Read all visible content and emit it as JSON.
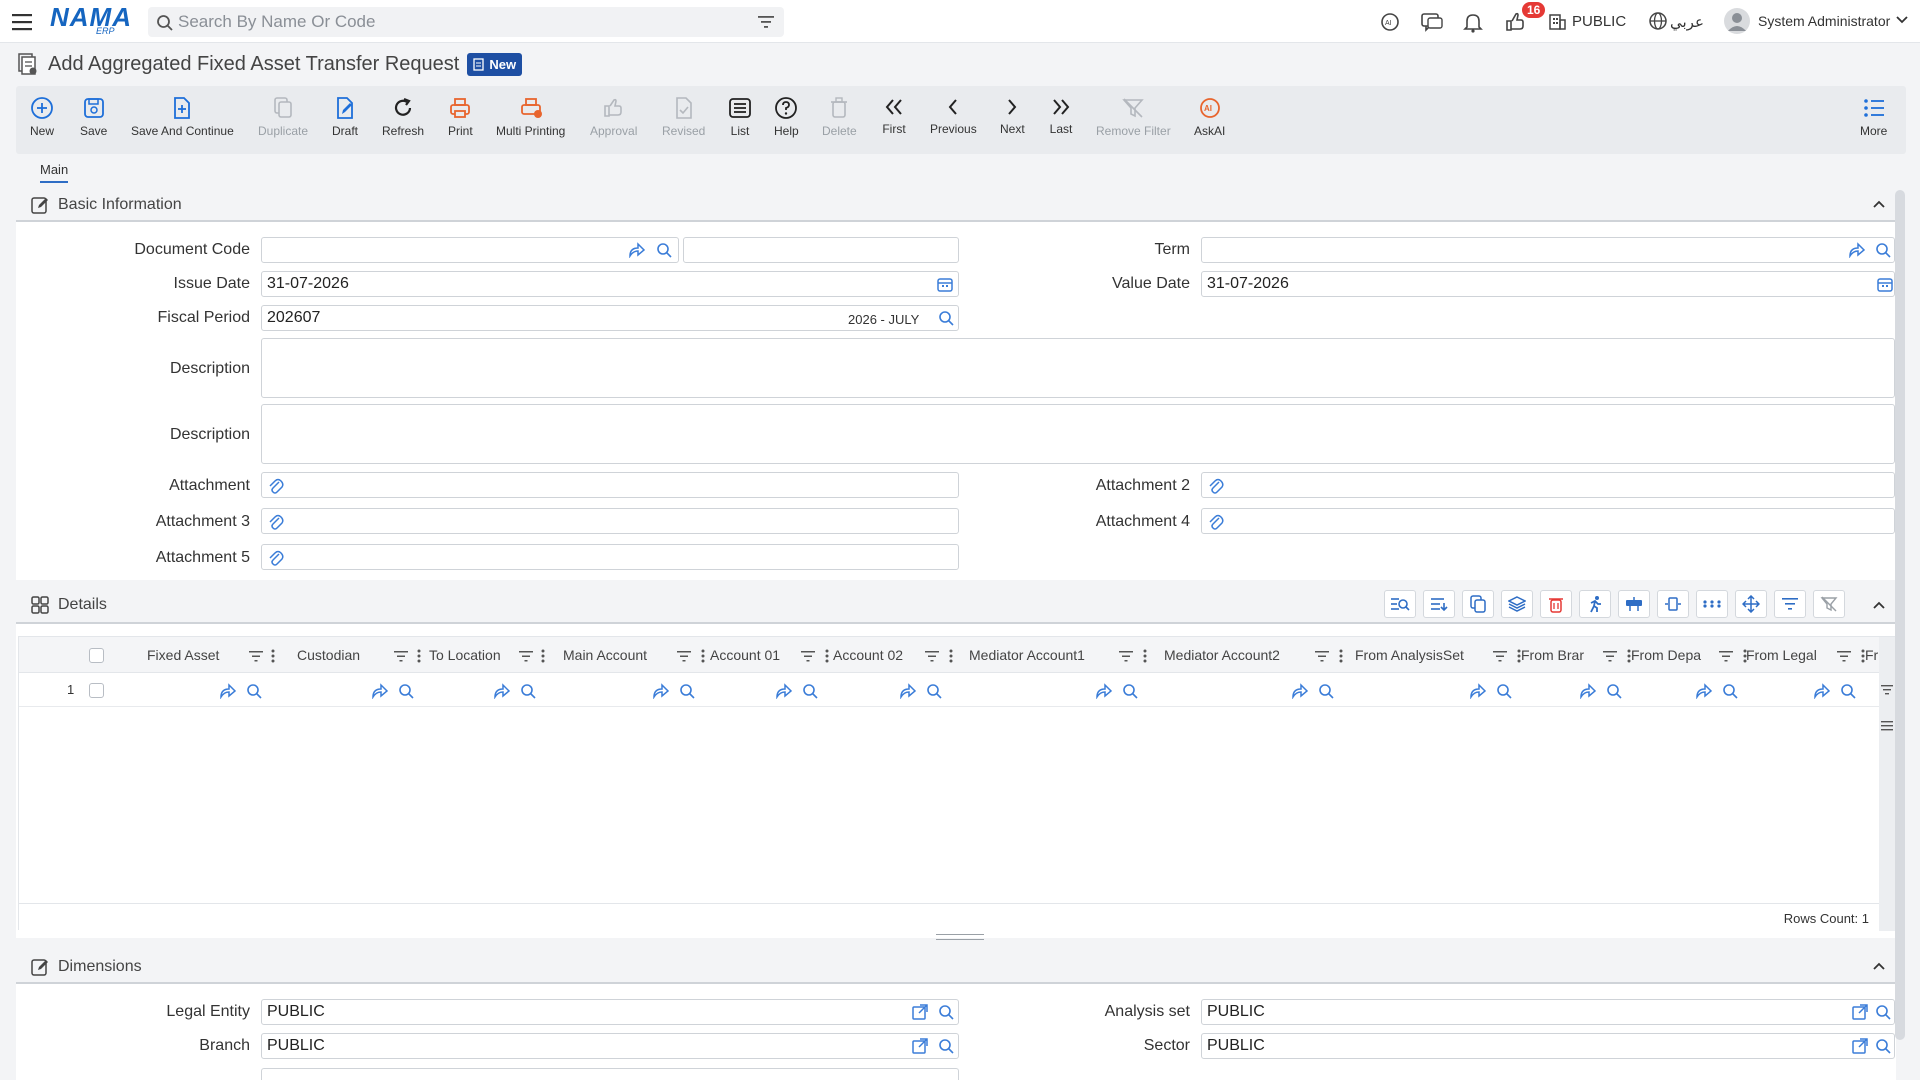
{
  "topbar": {
    "search_placeholder": "Search By Name Or Code",
    "notification_count": "16",
    "company": "PUBLIC",
    "language": "عربي",
    "user": "System Administrator"
  },
  "page": {
    "title": "Add Aggregated Fixed Asset Transfer Request",
    "status_badge": "New"
  },
  "toolbar": {
    "items": [
      {
        "label": "New",
        "icon": "plus-circle-icon"
      },
      {
        "label": "Save",
        "icon": "save-icon"
      },
      {
        "label": "Save And Continue",
        "icon": "save-continue-icon"
      },
      {
        "label": "Duplicate",
        "icon": "copy-icon"
      },
      {
        "label": "Draft",
        "icon": "draft-icon"
      },
      {
        "label": "Refresh",
        "icon": "refresh-icon"
      },
      {
        "label": "Print",
        "icon": "printer-icon"
      },
      {
        "label": "Multi Printing",
        "icon": "multi-print-icon"
      },
      {
        "label": "Approval",
        "icon": "thumbs-up-icon"
      },
      {
        "label": "Revised",
        "icon": "revised-icon"
      },
      {
        "label": "List",
        "icon": "list-icon"
      },
      {
        "label": "Help",
        "icon": "help-icon"
      },
      {
        "label": "Delete",
        "icon": "trash-icon"
      },
      {
        "label": "First",
        "icon": "double-chevron-left-icon"
      },
      {
        "label": "Previous",
        "icon": "chevron-left-icon"
      },
      {
        "label": "Next",
        "icon": "chevron-right-icon"
      },
      {
        "label": "Last",
        "icon": "double-chevron-right-icon"
      },
      {
        "label": "Remove Filter",
        "icon": "remove-filter-icon"
      },
      {
        "label": "AskAI",
        "icon": "ai-icon"
      }
    ],
    "more": "More"
  },
  "tabs": {
    "main": "Main"
  },
  "basic": {
    "title": "Basic Information",
    "document_code_label": "Document Code",
    "document_code": "",
    "term_label": "Term",
    "term": "",
    "issue_date_label": "Issue Date",
    "issue_date": "31-07-2026",
    "value_date_label": "Value Date",
    "value_date": "31-07-2026",
    "fiscal_period_label": "Fiscal Period",
    "fiscal_period": "202607",
    "fiscal_period_name": "2026 - JULY",
    "description_label": "Description",
    "description2_label": "Description",
    "attachment_label": "Attachment",
    "attachment2_label": "Attachment 2",
    "attachment3_label": "Attachment 3",
    "attachment4_label": "Attachment 4",
    "attachment5_label": "Attachment 5"
  },
  "details": {
    "title": "Details",
    "columns": [
      "Fixed Asset",
      "Custodian",
      "To Location",
      "Main Account",
      "Account 01",
      "Account 02",
      "Mediator Account1",
      "Mediator Account2",
      "From AnalysisSet",
      "From Brar",
      "From Depa",
      "From Legal",
      "Fr"
    ],
    "row_number": "1",
    "rows_count": "Rows Count: 1"
  },
  "dimensions": {
    "title": "Dimensions",
    "legal_entity_label": "Legal Entity",
    "legal_entity": "PUBLIC",
    "analysis_set_label": "Analysis set",
    "analysis_set": "PUBLIC",
    "branch_label": "Branch",
    "branch": "PUBLIC",
    "sector_label": "Sector",
    "sector": "PUBLIC"
  },
  "colors": {
    "accent": "#1e4fa3",
    "orange": "#e8652e",
    "badge": "#e53935"
  }
}
